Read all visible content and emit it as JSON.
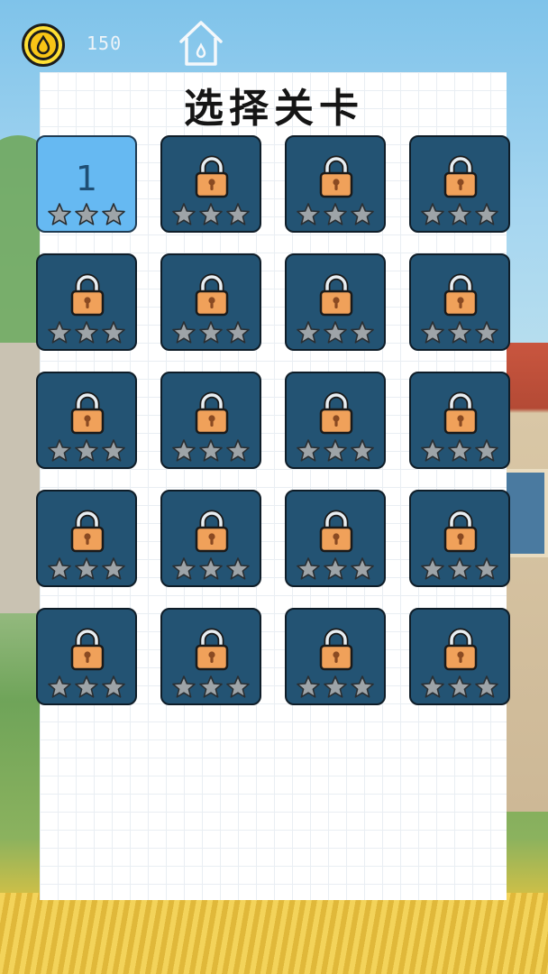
{
  "header": {
    "coin_icon": "droplet-coin-icon",
    "coins": "150",
    "home_icon": "home-icon"
  },
  "title": "选择关卡",
  "levels": [
    {
      "label": "1",
      "locked": false,
      "stars": 0
    },
    {
      "label": "",
      "locked": true,
      "stars": 0
    },
    {
      "label": "",
      "locked": true,
      "stars": 0
    },
    {
      "label": "",
      "locked": true,
      "stars": 0
    },
    {
      "label": "",
      "locked": true,
      "stars": 0
    },
    {
      "label": "",
      "locked": true,
      "stars": 0
    },
    {
      "label": "",
      "locked": true,
      "stars": 0
    },
    {
      "label": "",
      "locked": true,
      "stars": 0
    },
    {
      "label": "",
      "locked": true,
      "stars": 0
    },
    {
      "label": "",
      "locked": true,
      "stars": 0
    },
    {
      "label": "",
      "locked": true,
      "stars": 0
    },
    {
      "label": "",
      "locked": true,
      "stars": 0
    },
    {
      "label": "",
      "locked": true,
      "stars": 0
    },
    {
      "label": "",
      "locked": true,
      "stars": 0
    },
    {
      "label": "",
      "locked": true,
      "stars": 0
    },
    {
      "label": "",
      "locked": true,
      "stars": 0
    },
    {
      "label": "",
      "locked": true,
      "stars": 0
    },
    {
      "label": "",
      "locked": true,
      "stars": 0
    },
    {
      "label": "",
      "locked": true,
      "stars": 0
    },
    {
      "label": "",
      "locked": true,
      "stars": 0
    }
  ],
  "colors": {
    "locked_tile": "#235373",
    "unlocked_tile": "#66b9f2",
    "lock_body": "#f0a15a",
    "star_empty": "#9ea4a8"
  }
}
